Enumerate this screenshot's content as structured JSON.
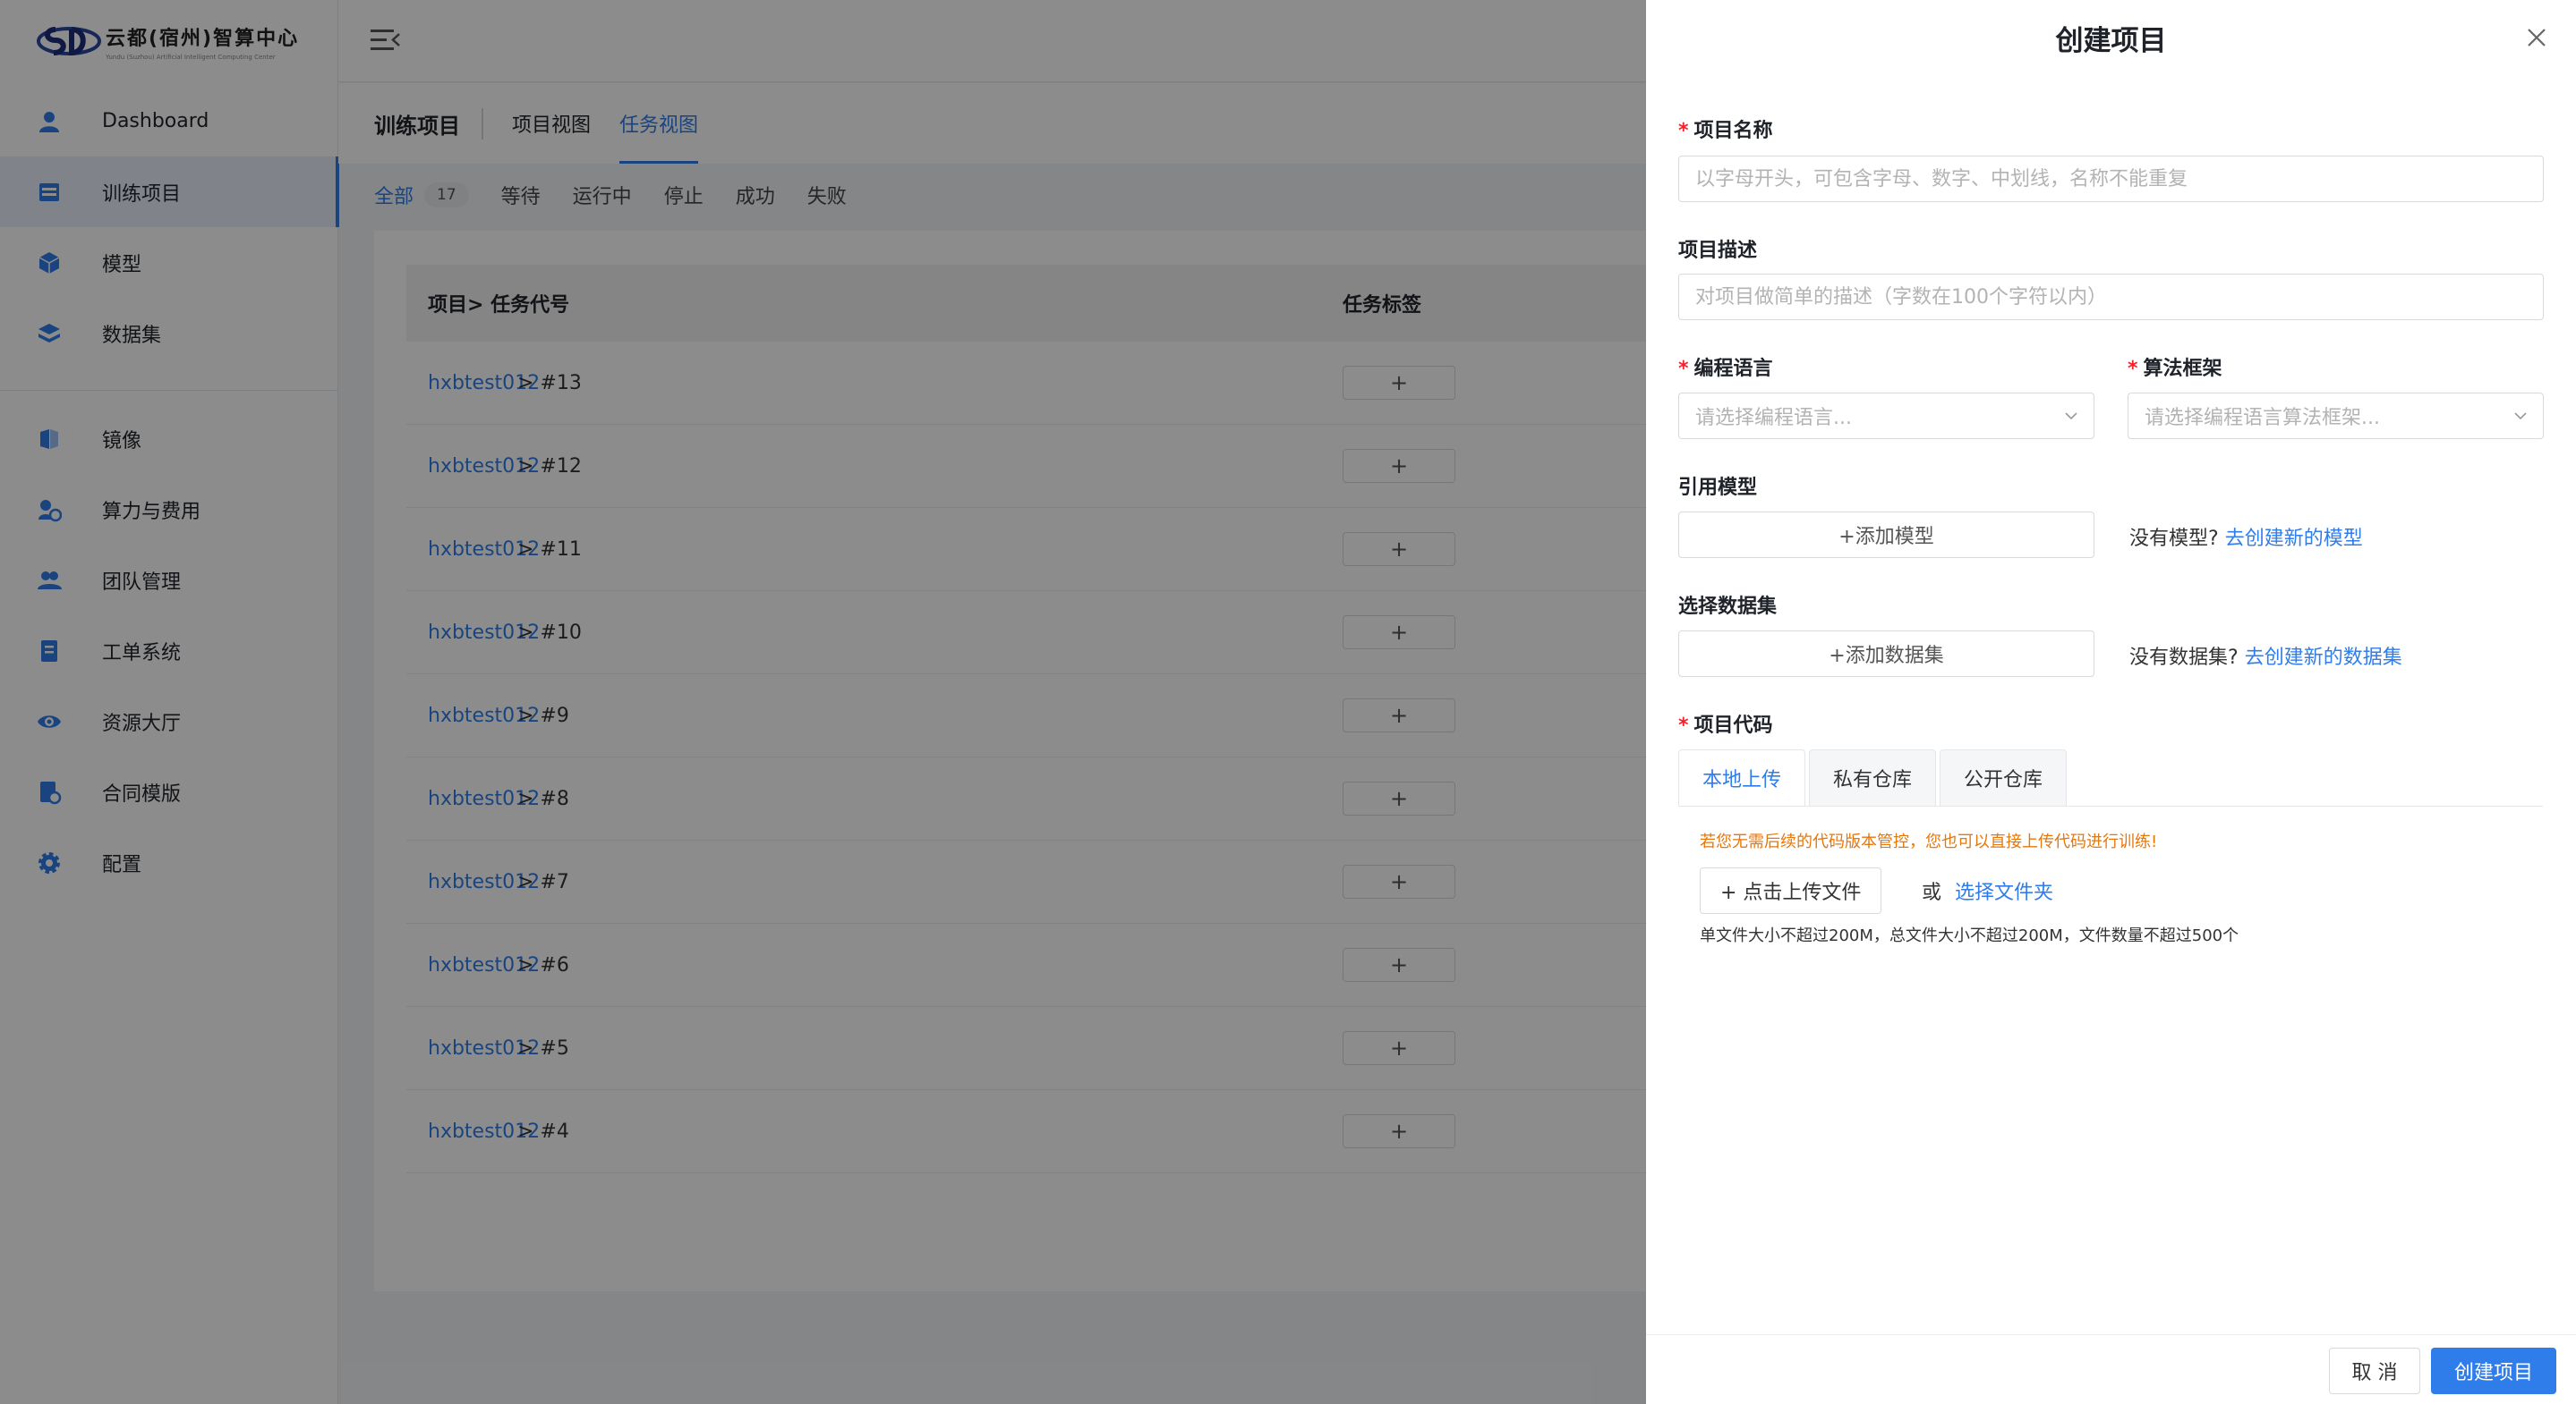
{
  "brand": {
    "title": "云都(宿州)智算中心",
    "subtitle": "Yundu (Suzhou) Artificial Intelligent Computing Center"
  },
  "sidebar": {
    "items": [
      {
        "label": "Dashboard",
        "icon": "user-icon"
      },
      {
        "label": "训练项目",
        "icon": "list-icon",
        "active": true
      },
      {
        "label": "模型",
        "icon": "cube-icon"
      },
      {
        "label": "数据集",
        "icon": "layers-icon"
      },
      {
        "label": "镜像",
        "icon": "image-icon"
      },
      {
        "label": "算力与费用",
        "icon": "billing-icon"
      },
      {
        "label": "团队管理",
        "icon": "team-icon"
      },
      {
        "label": "工单系统",
        "icon": "ticket-icon"
      },
      {
        "label": "资源大厅",
        "icon": "eye-icon"
      },
      {
        "label": "合同模版",
        "icon": "contract-icon"
      },
      {
        "label": "配置",
        "icon": "gear-icon"
      }
    ]
  },
  "tabs": {
    "title": "训练项目",
    "items": [
      "项目视图",
      "任务视图"
    ],
    "active": "任务视图"
  },
  "filters": {
    "all_label": "全部",
    "all_count": "17",
    "items": [
      "等待",
      "运行中",
      "停止",
      "成功",
      "失败"
    ]
  },
  "table": {
    "headers": {
      "project": "项目> 任务代号",
      "tags": "任务标签"
    },
    "rows": [
      {
        "project": "hxbtest012",
        "task": "> #13"
      },
      {
        "project": "hxbtest012",
        "task": "> #12"
      },
      {
        "project": "hxbtest012",
        "task": "> #11"
      },
      {
        "project": "hxbtest012",
        "task": "> #10"
      },
      {
        "project": "hxbtest012",
        "task": "> #9"
      },
      {
        "project": "hxbtest012",
        "task": "> #8"
      },
      {
        "project": "hxbtest012",
        "task": "> #7"
      },
      {
        "project": "hxbtest012",
        "task": "> #6"
      },
      {
        "project": "hxbtest012",
        "task": "> #5"
      },
      {
        "project": "hxbtest012",
        "task": "> #4"
      }
    ],
    "add_tag": "+"
  },
  "drawer": {
    "title": "创建项目",
    "name_label": "项目名称",
    "name_placeholder": "以字母开头，可包含字母、数字、中划线，名称不能重复",
    "desc_label": "项目描述",
    "desc_placeholder": "对项目做简单的描述（字数在100个字符以内）",
    "lang_label": "编程语言",
    "lang_placeholder": "请选择编程语言...",
    "framework_label": "算法框架",
    "framework_placeholder": "请选择编程语言算法框架...",
    "model_label": "引用模型",
    "add_model": "+添加模型",
    "no_model": "没有模型?",
    "create_model_link": "去创建新的模型",
    "dataset_label": "选择数据集",
    "add_dataset": "+添加数据集",
    "no_dataset": "没有数据集?",
    "create_dataset_link": "去创建新的数据集",
    "code_label": "项目代码",
    "code_tabs": [
      "本地上传",
      "私有仓库",
      "公开仓库"
    ],
    "warning": "若您无需后续的代码版本管控，您也可以直接上传代码进行训练!",
    "upload_button": "+ 点击上传文件",
    "or": "或",
    "select_folder": "选择文件夹",
    "limit": "单文件大小不超过200M，总文件大小不超过200M，文件数量不超过500个",
    "cancel": "取 消",
    "create": "创建项目"
  },
  "colors": {
    "accent": "#2f7dea",
    "warning": "#e6770d",
    "required": "#f5222d"
  }
}
